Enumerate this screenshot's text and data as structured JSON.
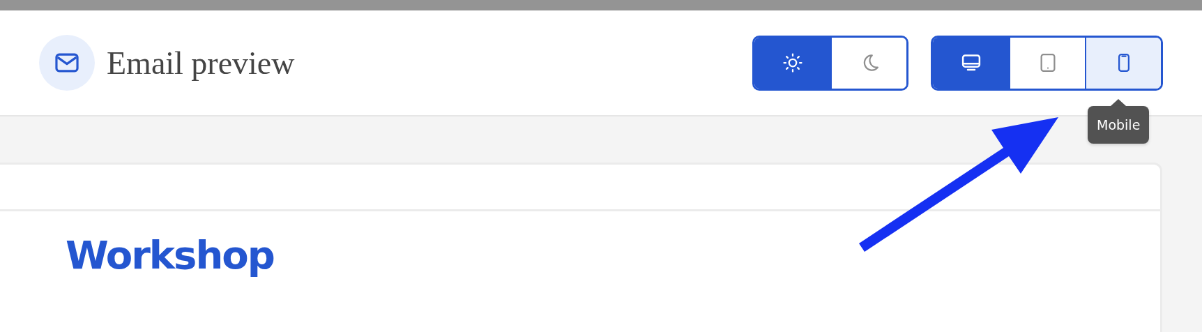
{
  "header": {
    "title": "Email preview"
  },
  "theme_toggle": [
    {
      "kind": "light",
      "selected": true
    },
    {
      "kind": "dark",
      "selected": false
    }
  ],
  "device_toggle": [
    {
      "kind": "desktop",
      "selected": true,
      "hovered": false
    },
    {
      "kind": "tablet",
      "selected": false,
      "hovered": false
    },
    {
      "kind": "mobile",
      "selected": false,
      "hovered": true
    }
  ],
  "tooltip": {
    "text": "Mobile"
  },
  "email": {
    "brand": "Workshop"
  }
}
